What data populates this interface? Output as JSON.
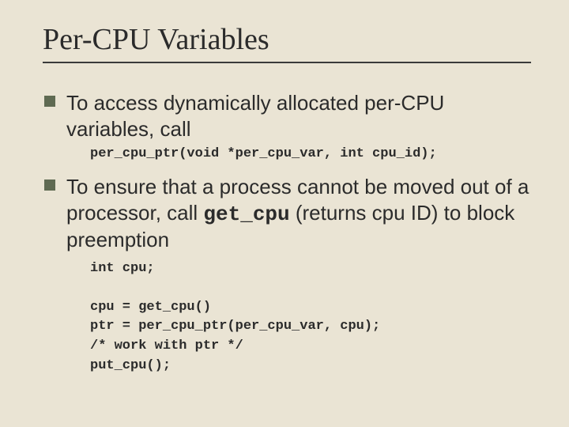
{
  "title": "Per-CPU Variables",
  "bullets": [
    {
      "text_before": "To access dynamically allocated per-CPU variables, call",
      "code_after": "per_cpu_ptr(void *per_cpu_var, int cpu_id);"
    },
    {
      "text_before": "To ensure that a process cannot be moved out of a processor, call ",
      "inline_code": "get_cpu",
      "text_after": " (returns cpu ID) to block preemption",
      "code_block": "int cpu;\n\ncpu = get_cpu()\nptr = per_cpu_ptr(per_cpu_var, cpu);\n/* work with ptr */\nput_cpu();"
    }
  ]
}
